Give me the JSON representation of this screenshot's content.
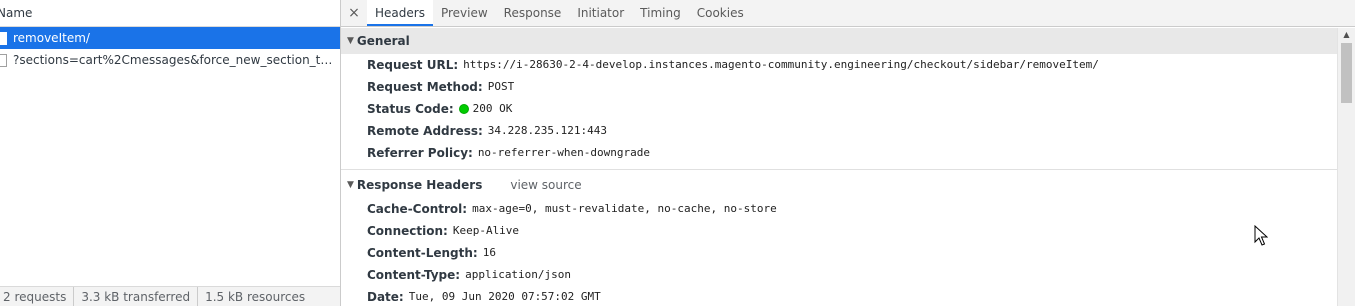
{
  "request_list": {
    "column_header": "Name",
    "items": [
      {
        "name": "removeItem/",
        "selected": true
      },
      {
        "name": "?sections=cart%2Cmessages&force_new_section_timestam...",
        "selected": false
      }
    ],
    "summary": {
      "requests": "2 requests",
      "transferred": "3.3 kB transferred",
      "resources": "1.5 kB resources"
    }
  },
  "tabs": {
    "close": "×",
    "items": [
      "Headers",
      "Preview",
      "Response",
      "Initiator",
      "Timing",
      "Cookies"
    ],
    "active": "Headers"
  },
  "general": {
    "title": "General",
    "rows": [
      {
        "key": "Request URL:",
        "value": "https://i-28630-2-4-develop.instances.magento-community.engineering/checkout/sidebar/removeItem/"
      },
      {
        "key": "Request Method:",
        "value": "POST"
      },
      {
        "key": "Status Code:",
        "value": "200 OK"
      },
      {
        "key": "Remote Address:",
        "value": "34.228.235.121:443"
      },
      {
        "key": "Referrer Policy:",
        "value": "no-referrer-when-downgrade"
      }
    ]
  },
  "response_headers": {
    "title": "Response Headers",
    "view_source": "view source",
    "rows": [
      {
        "key": "Cache-Control:",
        "value": "max-age=0, must-revalidate, no-cache, no-store"
      },
      {
        "key": "Connection:",
        "value": "Keep-Alive"
      },
      {
        "key": "Content-Length:",
        "value": "16"
      },
      {
        "key": "Content-Type:",
        "value": "application/json"
      },
      {
        "key": "Date:",
        "value": "Tue, 09 Jun 2020 07:57:02 GMT"
      }
    ]
  },
  "colors": {
    "selected_row": "#1a73e8",
    "status_ok": "#00cc00"
  }
}
